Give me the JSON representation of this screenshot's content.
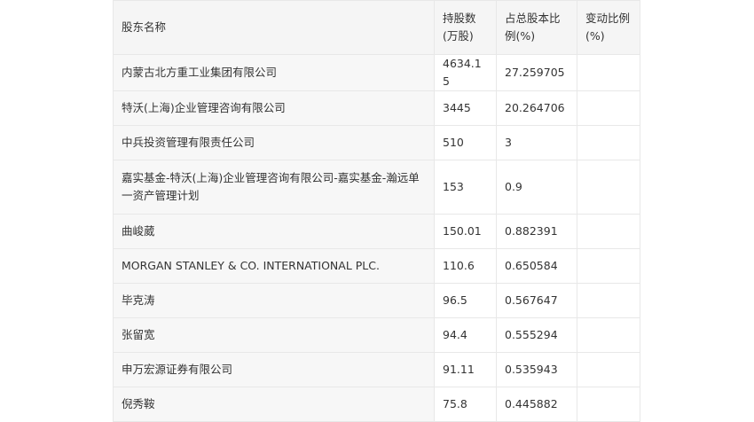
{
  "table": {
    "headers": [
      "股东名称",
      "持股数(万股)",
      "占总股本比例(%)",
      "变动比例(%)"
    ],
    "rows": [
      {
        "name": "内蒙古北方重工业集团有限公司",
        "shares": "4634.15",
        "ratio": "27.259705",
        "change": ""
      },
      {
        "name": "特沃(上海)企业管理咨询有限公司",
        "shares": "3445",
        "ratio": "20.264706",
        "change": ""
      },
      {
        "name": "中兵投资管理有限责任公司",
        "shares": "510",
        "ratio": "3",
        "change": ""
      },
      {
        "name": "嘉实基金-特沃(上海)企业管理咨询有限公司-嘉实基金-瀚远单一资产管理计划",
        "shares": "153",
        "ratio": "0.9",
        "change": ""
      },
      {
        "name": "曲峻葳",
        "shares": "150.01",
        "ratio": "0.882391",
        "change": ""
      },
      {
        "name": "MORGAN STANLEY & CO. INTERNATIONAL PLC.",
        "shares": "110.6",
        "ratio": "0.650584",
        "change": ""
      },
      {
        "name": "毕克涛",
        "shares": "96.5",
        "ratio": "0.567647",
        "change": ""
      },
      {
        "name": "张留宽",
        "shares": "94.4",
        "ratio": "0.555294",
        "change": ""
      },
      {
        "name": "申万宏源证券有限公司",
        "shares": "91.11",
        "ratio": "0.535943",
        "change": ""
      },
      {
        "name": "倪秀鞍",
        "shares": "75.8",
        "ratio": "0.445882",
        "change": ""
      }
    ]
  }
}
